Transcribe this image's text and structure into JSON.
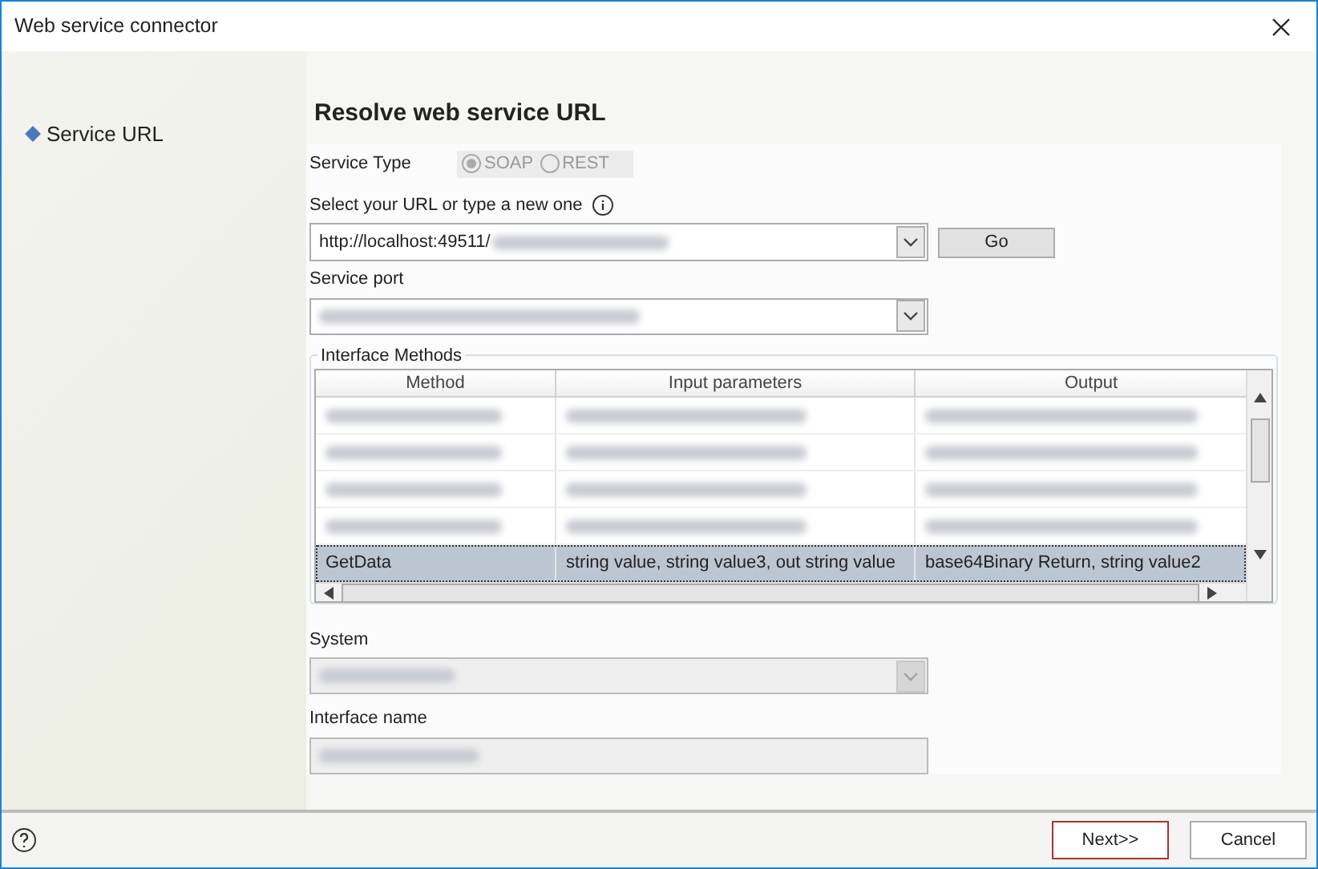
{
  "window": {
    "title": "Web service connector"
  },
  "sidebar": {
    "items": [
      {
        "label": "Service URL",
        "selected": true
      }
    ]
  },
  "heading": "Resolve web service URL",
  "service_type": {
    "label": "Service Type",
    "disabled": true,
    "options": [
      {
        "label": "SOAP",
        "selected": true
      },
      {
        "label": "REST",
        "selected": false
      }
    ]
  },
  "url": {
    "label": "Select your URL or type a new one",
    "value": "http://localhost:49511/",
    "redacted_tail": true
  },
  "go_button": "Go",
  "service_port": {
    "label": "Service port",
    "redacted": true
  },
  "methods": {
    "legend": "Interface Methods",
    "columns": [
      "Method",
      "Input parameters",
      "Output"
    ],
    "rows": [
      {
        "kind": "redacted",
        "selected": false
      },
      {
        "kind": "redacted",
        "selected": false
      },
      {
        "kind": "redacted",
        "selected": false
      },
      {
        "kind": "redacted",
        "selected": false
      },
      {
        "kind": "text",
        "selected": true,
        "cells": [
          "GetData",
          "string value, string value3, out string value",
          "base64Binary Return, string value2"
        ]
      }
    ]
  },
  "system": {
    "label": "System",
    "disabled": true,
    "redacted": true
  },
  "interface_name": {
    "label": "Interface name",
    "disabled": true,
    "redacted": true
  },
  "buttons": [
    {
      "label": "Next>>",
      "focused": true
    },
    {
      "label": "Cancel",
      "focused": false
    }
  ]
}
